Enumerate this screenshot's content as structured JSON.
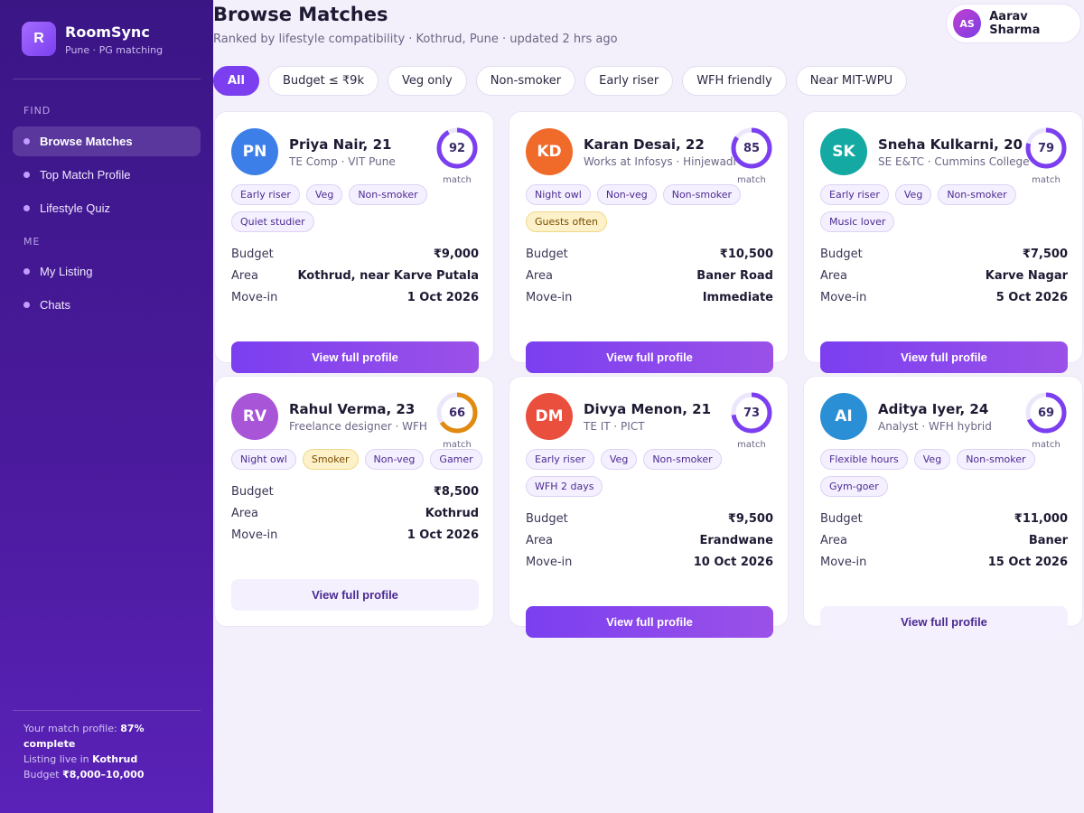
{
  "brand": {
    "logo_letter": "R",
    "name": "RoomSync",
    "sub": "Pune · PG matching"
  },
  "nav": {
    "find_label": "FIND",
    "find_items": [
      {
        "label": "Browse Matches",
        "active": true
      },
      {
        "label": "Top Match Profile",
        "active": false
      },
      {
        "label": "Lifestyle Quiz",
        "active": false
      }
    ],
    "me_label": "ME",
    "me_items": [
      {
        "label": "My Listing",
        "active": false
      },
      {
        "label": "Chats",
        "active": false
      }
    ]
  },
  "sidebar_footer": {
    "profile_prefix": "Your match profile:",
    "profile_value": "87% complete",
    "listing_prefix": "Listing live in",
    "listing_value": "Kothrud",
    "budget_prefix": "Budget",
    "budget_value": "₹8,000–10,000"
  },
  "header": {
    "title": "Browse Matches",
    "subtitle": "Ranked by lifestyle compatibility · Kothrud, Pune · updated 2 hrs ago"
  },
  "user": {
    "initials": "AS",
    "name": "Aarav Sharma"
  },
  "filters": [
    {
      "label": "All",
      "active": true
    },
    {
      "label": "Budget ≤ ₹9k",
      "active": false
    },
    {
      "label": "Veg only",
      "active": false
    },
    {
      "label": "Non-smoker",
      "active": false
    },
    {
      "label": "Early riser",
      "active": false
    },
    {
      "label": "WFH friendly",
      "active": false
    },
    {
      "label": "Near MIT-WPU",
      "active": false
    }
  ],
  "labels": {
    "match": "match",
    "budget": "Budget",
    "area": "Area",
    "move_in": "Move-in",
    "view_profile": "View full profile"
  },
  "cards": [
    {
      "initials": "PN",
      "name": "Priya Nair, 21",
      "sub": "TE Comp · VIT Pune",
      "score": 92,
      "ring_color": "#7b3ff0",
      "avatar_color": "#3d7fe8",
      "tags": [
        {
          "text": "Early riser",
          "warn": false
        },
        {
          "text": "Veg",
          "warn": false
        },
        {
          "text": "Non-smoker",
          "warn": false
        },
        {
          "text": "Quiet studier",
          "warn": false
        }
      ],
      "budget": "₹9,000",
      "area": "Kothrud, near Karve Putala",
      "move_in": "1 Oct 2026",
      "primary": true
    },
    {
      "initials": "KD",
      "name": "Karan Desai, 22",
      "sub": "Works at Infosys · Hinjewadi",
      "score": 85,
      "ring_color": "#7b3ff0",
      "avatar_color": "#f06a2a",
      "tags": [
        {
          "text": "Night owl",
          "warn": false
        },
        {
          "text": "Non-veg",
          "warn": false
        },
        {
          "text": "Non-smoker",
          "warn": false
        },
        {
          "text": "Guests often",
          "warn": true
        }
      ],
      "budget": "₹10,500",
      "area": "Baner Road",
      "move_in": "Immediate",
      "primary": true
    },
    {
      "initials": "SK",
      "name": "Sneha Kulkarni, 20",
      "sub": "SE E&TC · Cummins College",
      "score": 79,
      "ring_color": "#7b3ff0",
      "avatar_color": "#14a9a3",
      "tags": [
        {
          "text": "Early riser",
          "warn": false
        },
        {
          "text": "Veg",
          "warn": false
        },
        {
          "text": "Non-smoker",
          "warn": false
        },
        {
          "text": "Music lover",
          "warn": false
        }
      ],
      "budget": "₹7,500",
      "area": "Karve Nagar",
      "move_in": "5 Oct 2026",
      "primary": true
    },
    {
      "initials": "RV",
      "name": "Rahul Verma, 23",
      "sub": "Freelance designer · WFH",
      "score": 66,
      "ring_color": "#e08a10",
      "avatar_color": "#a855d8",
      "tags": [
        {
          "text": "Night owl",
          "warn": false
        },
        {
          "text": "Smoker",
          "warn": true
        },
        {
          "text": "Non-veg",
          "warn": false
        },
        {
          "text": "Gamer",
          "warn": false
        }
      ],
      "budget": "₹8,500",
      "area": "Kothrud",
      "move_in": "1 Oct 2026",
      "primary": false
    },
    {
      "initials": "DM",
      "name": "Divya Menon, 21",
      "sub": "TE IT · PICT",
      "score": 73,
      "ring_color": "#7b3ff0",
      "avatar_color": "#ea4f3e",
      "tags": [
        {
          "text": "Early riser",
          "warn": false
        },
        {
          "text": "Veg",
          "warn": false
        },
        {
          "text": "Non-smoker",
          "warn": false
        },
        {
          "text": "WFH 2 days",
          "warn": false
        }
      ],
      "budget": "₹9,500",
      "area": "Erandwane",
      "move_in": "10 Oct 2026",
      "primary": true
    },
    {
      "initials": "AI",
      "name": "Aditya Iyer, 24",
      "sub": "Analyst · WFH hybrid",
      "score": 69,
      "ring_color": "#7b3ff0",
      "avatar_color": "#2b8fd6",
      "tags": [
        {
          "text": "Flexible hours",
          "warn": false
        },
        {
          "text": "Veg",
          "warn": false
        },
        {
          "text": "Non-smoker",
          "warn": false
        },
        {
          "text": "Gym-goer",
          "warn": false
        }
      ],
      "budget": "₹11,000",
      "area": "Baner",
      "move_in": "15 Oct 2026",
      "primary": false
    }
  ]
}
